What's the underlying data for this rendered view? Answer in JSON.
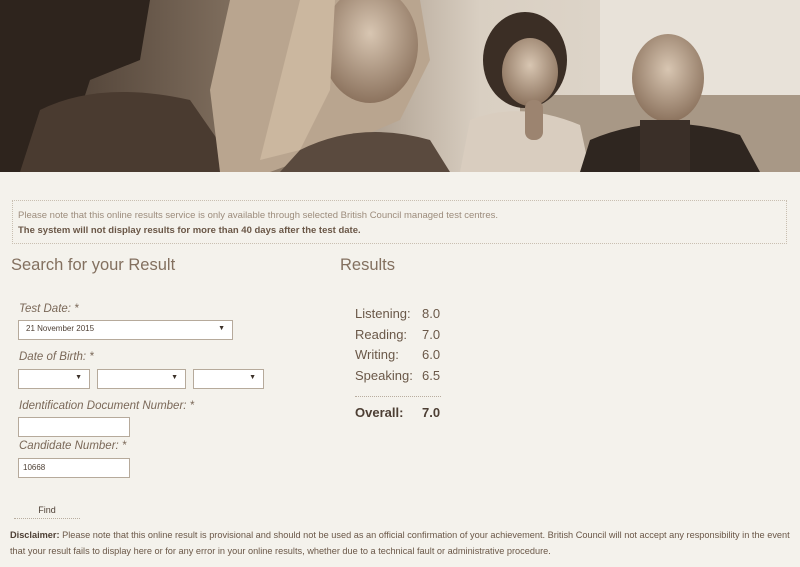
{
  "notice": {
    "line1": "Please note that this online results service is only available through selected British Council managed test centres.",
    "line2": "The system will not display results for more than 40 days after the test date."
  },
  "search": {
    "title": "Search for your Result",
    "test_date_label": "Test Date: *",
    "test_date_value": "21 November 2015",
    "dob_label": "Date of Birth: *",
    "dob_day": "",
    "dob_month": "",
    "dob_year": "",
    "id_label": "Identification Document Number: *",
    "id_value": "",
    "candidate_label": "Candidate Number: *",
    "candidate_value": "10668",
    "find_label": "Find"
  },
  "results": {
    "title": "Results",
    "scores": [
      {
        "label": "Listening:",
        "value": "8.0"
      },
      {
        "label": "Reading:",
        "value": "7.0"
      },
      {
        "label": "Writing:",
        "value": "6.0"
      },
      {
        "label": "Speaking:",
        "value": "6.5"
      }
    ],
    "overall_label": "Overall:",
    "overall_value": "7.0"
  },
  "disclaimer": {
    "heading": "Disclaimer:",
    "text": "Please note that this online result is provisional and should not be used as an official confirmation of your achievement. British Council will not accept any responsibility in the event that your result fails to display here or for any error in your online results, whether due to a technical fault or administrative procedure."
  }
}
